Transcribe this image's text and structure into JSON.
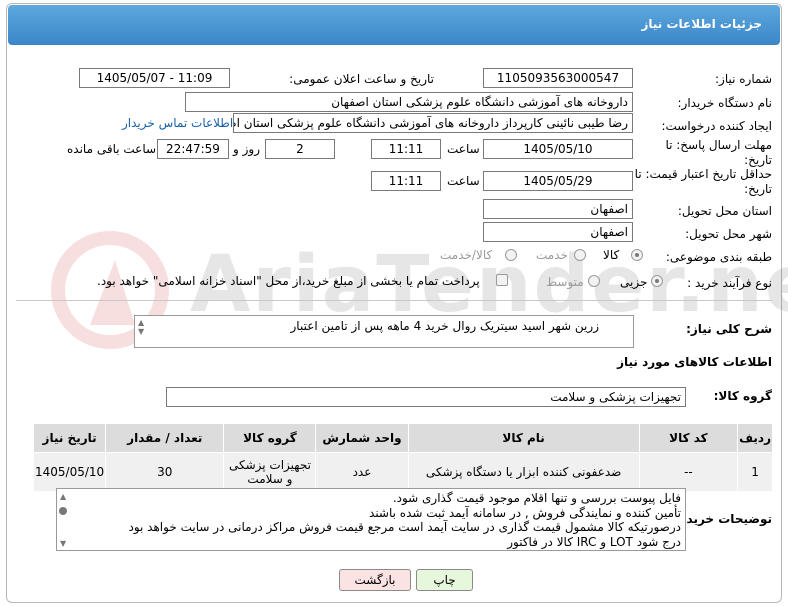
{
  "header": {
    "title": "جزئیات اطلاعات نیاز"
  },
  "fields": {
    "need_number_label": "شماره نیاز:",
    "need_number": "1105093563000547",
    "announce_label": "تاریخ و ساعت اعلان عمومی:",
    "announce_value": "1405/05/07 - 11:09",
    "buyer_org_label": "نام دستگاه خریدار:",
    "buyer_org": "داروخانه های آموزشی دانشگاه علوم پزشکی استان اصفهان",
    "requester_label": "ایجاد کننده درخواست:",
    "requester": "رضا طیبی نائینی کارپرداز داروخانه های آموزشی دانشگاه علوم پزشکی استان اصفهان",
    "contact_link": "اطلاعات تماس خریدار",
    "deadline_label": "مهلت ارسال پاسخ: تا تاریخ:",
    "deadline_date": "1405/05/10",
    "time_label": "ساعت",
    "deadline_time": "11:11",
    "days_count": "2",
    "days_label": "روز و",
    "remaining_time": "22:47:59",
    "remaining_label": "ساعت باقی مانده",
    "min_validity_label": "حداقل تاریخ اعتبار قیمت: تا تاریخ:",
    "validity_date": "1405/05/29",
    "validity_time": "11:11",
    "province_label": "استان محل تحویل:",
    "province": "اصفهان",
    "city_label": "شهر محل تحویل:",
    "city": "اصفهان",
    "category_label": "طبقه بندی موضوعی:",
    "category_options": [
      "کالا",
      "خدمت",
      "کالا/خدمت"
    ],
    "purchase_type_label": "نوع فرآیند خرید :",
    "purchase_type_options": [
      "جزیی",
      "متوسط"
    ],
    "payment_note": "پرداخت تمام یا بخشی از مبلغ خرید،از محل \"اسناد خزانه اسلامی\" خواهد بود."
  },
  "description": {
    "label": "شرح کلی نیاز:",
    "text": "زرین شهر اسید سیتریک  روال خرید 4 ماهه پس از تامین اعتبار"
  },
  "goods": {
    "section_title": "اطلاعات کالاهای مورد نیاز",
    "group_label": "گروه کالا:",
    "group_value": "تجهیزات پزشکی و سلامت",
    "columns": [
      "ردیف",
      "کد کالا",
      "نام کالا",
      "واحد شمارش",
      "گروه کالا",
      "تعداد / مقدار",
      "تاریخ نیاز"
    ],
    "rows": [
      {
        "index": "1",
        "code": "--",
        "name": "ضدعفونی کننده ابزار یا دستگاه پزشکی",
        "unit": "عدد",
        "group": "تجهیزات پزشکی و سلامت",
        "qty": "30",
        "date": "1405/05/10"
      }
    ]
  },
  "buyer_notes": {
    "label": "توضیحات خریدار:",
    "lines": [
      "فایل پیوست بررسی و تنها اقلام موجود قیمت گذاری شود.",
      "تأمین کننده و نمایندگی فروش  , در سامانه آیمد ثبت شده باشند",
      "درصورتیکه کالا مشمول قیمت گذاری در سایت آیمد است مرجع قیمت فروش مراکز درمانی در سایت خواهد بود",
      "درج شود LOT و IRC کالا در فاکتور"
    ]
  },
  "buttons": {
    "print": "چاپ",
    "back": "بازگشت"
  },
  "watermark": {
    "text": "AriaTender.net"
  },
  "colors": {
    "header": "#3a86c8",
    "print_button": "#e6f7dc",
    "back_button": "#fbe3e3"
  }
}
